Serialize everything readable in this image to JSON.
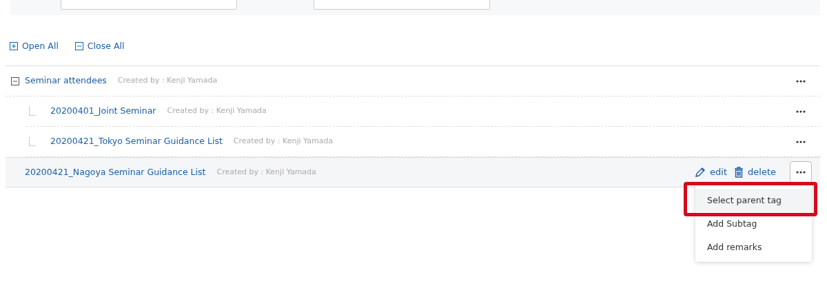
{
  "filter_panel": {
    "fields": [
      {
        "kind": "text"
      },
      {
        "kind": "text"
      }
    ]
  },
  "toolbar": [
    {
      "kind": "expand",
      "label": "Open All"
    },
    {
      "kind": "collapse",
      "label": "Close All"
    }
  ],
  "tags": [
    {
      "name": "Seminar attendees",
      "creator": "Created by : Kenji Yamada",
      "expanded": true,
      "selected": false,
      "children": [
        {
          "name": "20200401_Joint Seminar",
          "creator": "Created by : Kenji Yamada",
          "selected": false
        },
        {
          "name": "20200421_Tokyo Seminar Guidance List",
          "creator": "Created by : Kenji Yamada",
          "selected": false
        }
      ]
    },
    {
      "name": "20200421_Nagoya Seminar Guidance List",
      "creator": "Created by : Kenji Yamada",
      "selected": true,
      "actions": [
        "edit",
        "delete"
      ]
    }
  ],
  "menu": {
    "items": [
      {
        "label": "Select parent tag",
        "selected": true,
        "annotated": true
      },
      {
        "label": "Add Subtag",
        "selected": false,
        "annotated": false
      },
      {
        "label": "Add remarks",
        "selected": false,
        "annotated": false
      }
    ]
  }
}
